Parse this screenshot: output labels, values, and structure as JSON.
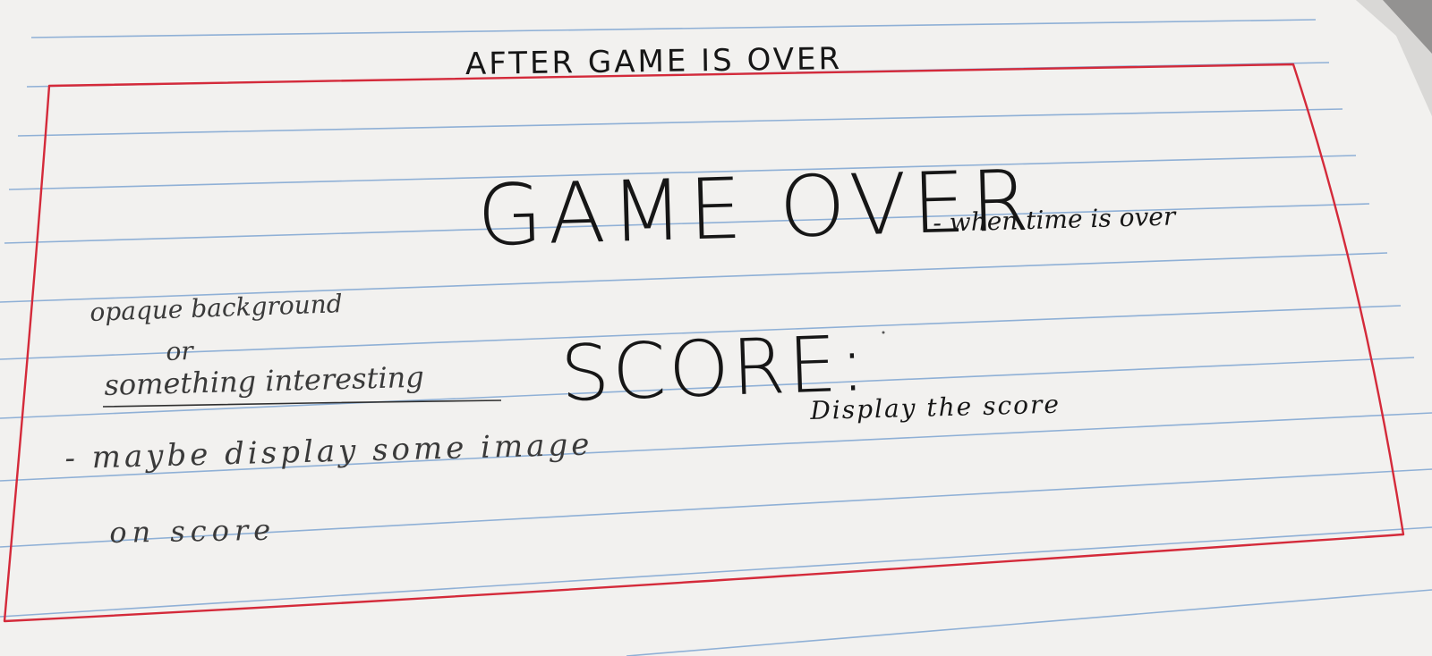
{
  "sketch": {
    "header": "AFTER GAME IS OVER",
    "title": "GAME OVER",
    "title_note": "- when time is over",
    "background_note": {
      "line1": "opaque background",
      "line2": "or",
      "line3": "something interesting"
    },
    "score_label": "SCORE:",
    "score_note": "Display the score",
    "image_note": {
      "line1": "- maybe display some image",
      "line2": "on score"
    }
  },
  "colors": {
    "paper": "#f2f1ef",
    "rule_line": "#8fb0d6",
    "border": "#d42a3a",
    "ink": "#161616",
    "pencil": "#3a3a3a"
  }
}
